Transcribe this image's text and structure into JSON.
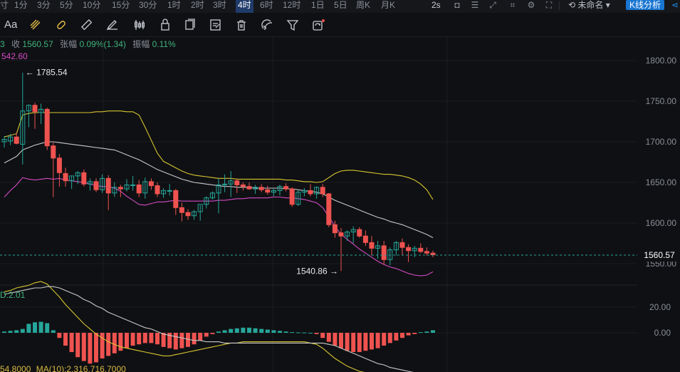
{
  "timeframes": {
    "items": [
      "寸",
      "1分",
      "3分",
      "5分",
      "10分",
      "15分",
      "30分",
      "1时",
      "2时",
      "3时",
      "4时",
      "6时",
      "12时",
      "1日",
      "5日",
      "周K",
      "月K"
    ],
    "active": "4时"
  },
  "topbar": {
    "interval": "2s",
    "layout_name": "未命名",
    "analysis_button": "K线分析"
  },
  "toolbar": {
    "font_tool_label": "Aa",
    "icons": [
      "line-tool-icon",
      "ray-tool-icon",
      "ruler-icon",
      "pen-icon",
      "candlestick-icon",
      "lock-icon",
      "copy-icon",
      "edit-icon",
      "trash-icon",
      "magnet-icon",
      "filter-icon",
      "sync-icon"
    ]
  },
  "info": {
    "prefix": "3",
    "close_label": "收",
    "close_value": "1560.57",
    "change_label": "张幅",
    "change_value": "0.09%(1.34)",
    "amplitude_label": "振幅",
    "amplitude_value": "0.11%",
    "ma_value": "542.60"
  },
  "colors": {
    "up": "#26a69a",
    "down": "#ef5350",
    "upper_band": "#d7c531",
    "mid_band": "#c8c8c8",
    "lower_band": "#d34bc5",
    "current_line": "#26a69a",
    "dif": "#d7c531",
    "dea": "#c8c8c8"
  },
  "price_axis": {
    "ticks": [
      "1800.00",
      "1750.00",
      "1700.00",
      "1650.00",
      "1600.00",
      "1550.00"
    ],
    "tick_values": [
      1800,
      1750,
      1700,
      1650,
      1600,
      1550
    ],
    "current_price": "1560.57"
  },
  "annotations": {
    "high": "1785.54",
    "low": "1540.86"
  },
  "macd_panel": {
    "label": "D:2.01",
    "ticks": [
      "20.00",
      "0.00"
    ],
    "tick_values": [
      20,
      0
    ]
  },
  "volume_line": {
    "text_a": "54.8000",
    "text_b": "MA(10):2,316,716.7000"
  },
  "chart_data": {
    "type": "candlestick",
    "series": [
      {
        "name": "candles",
        "ohlc": [
          [
            1700,
            1707,
            1693,
            1703
          ],
          [
            1701,
            1710,
            1696,
            1706
          ],
          [
            1706,
            1712,
            1697,
            1698
          ],
          [
            1697,
            1785,
            1672,
            1738
          ],
          [
            1738,
            1746,
            1718,
            1745
          ],
          [
            1745,
            1748,
            1716,
            1737
          ],
          [
            1736,
            1747,
            1722,
            1740
          ],
          [
            1740,
            1742,
            1690,
            1695
          ],
          [
            1695,
            1699,
            1632,
            1680
          ],
          [
            1680,
            1685,
            1645,
            1662
          ],
          [
            1661,
            1668,
            1645,
            1652
          ],
          [
            1652,
            1658,
            1642,
            1658
          ],
          [
            1658,
            1664,
            1648,
            1662
          ],
          [
            1662,
            1666,
            1645,
            1648
          ],
          [
            1648,
            1655,
            1640,
            1651
          ],
          [
            1651,
            1655,
            1638,
            1641
          ],
          [
            1641,
            1660,
            1637,
            1655
          ],
          [
            1655,
            1659,
            1616,
            1637
          ],
          [
            1637,
            1650,
            1632,
            1644
          ],
          [
            1644,
            1647,
            1632,
            1642
          ],
          [
            1642,
            1654,
            1639,
            1647
          ],
          [
            1647,
            1658,
            1640,
            1647
          ],
          [
            1647,
            1653,
            1632,
            1637
          ],
          [
            1637,
            1656,
            1630,
            1651
          ],
          [
            1651,
            1655,
            1641,
            1646
          ],
          [
            1646,
            1650,
            1632,
            1636
          ],
          [
            1636,
            1643,
            1631,
            1640
          ],
          [
            1640,
            1648,
            1634,
            1640
          ],
          [
            1640,
            1642,
            1610,
            1619
          ],
          [
            1619,
            1625,
            1602,
            1613
          ],
          [
            1613,
            1617,
            1604,
            1609
          ],
          [
            1609,
            1616,
            1604,
            1614
          ],
          [
            1614,
            1622,
            1603,
            1623
          ],
          [
            1623,
            1633,
            1618,
            1631
          ],
          [
            1631,
            1639,
            1629,
            1637
          ],
          [
            1637,
            1655,
            1612,
            1647
          ],
          [
            1647,
            1660,
            1638,
            1648
          ],
          [
            1648,
            1664,
            1632,
            1652
          ],
          [
            1652,
            1655,
            1637,
            1647
          ],
          [
            1647,
            1650,
            1640,
            1645
          ],
          [
            1645,
            1650,
            1641,
            1642
          ],
          [
            1642,
            1647,
            1636,
            1644
          ],
          [
            1644,
            1648,
            1638,
            1641
          ],
          [
            1641,
            1646,
            1635,
            1638
          ],
          [
            1638,
            1643,
            1633,
            1640
          ],
          [
            1640,
            1647,
            1634,
            1645
          ],
          [
            1645,
            1649,
            1639,
            1642
          ],
          [
            1642,
            1644,
            1620,
            1623
          ],
          [
            1623,
            1640,
            1621,
            1638
          ],
          [
            1638,
            1643,
            1633,
            1640
          ],
          [
            1640,
            1648,
            1633,
            1636
          ],
          [
            1636,
            1645,
            1630,
            1644
          ],
          [
            1644,
            1648,
            1632,
            1636
          ],
          [
            1636,
            1637,
            1595,
            1598
          ],
          [
            1598,
            1603,
            1582,
            1588
          ],
          [
            1588,
            1594,
            1541,
            1584
          ],
          [
            1584,
            1591,
            1578,
            1589
          ],
          [
            1589,
            1596,
            1575,
            1592
          ],
          [
            1592,
            1595,
            1582,
            1584
          ],
          [
            1584,
            1591,
            1572,
            1576
          ],
          [
            1576,
            1584,
            1560,
            1569
          ],
          [
            1569,
            1578,
            1556,
            1572
          ],
          [
            1572,
            1578,
            1549,
            1555
          ],
          [
            1555,
            1570,
            1548,
            1567
          ],
          [
            1567,
            1578,
            1560,
            1576
          ],
          [
            1576,
            1581,
            1561,
            1570
          ],
          [
            1570,
            1574,
            1552,
            1566
          ],
          [
            1566,
            1572,
            1558,
            1569
          ],
          [
            1569,
            1575,
            1563,
            1565
          ],
          [
            1565,
            1570,
            1560,
            1563
          ],
          [
            1563,
            1566,
            1558,
            1561
          ]
        ]
      },
      {
        "name": "upper_band",
        "values": [
          1706,
          1708,
          1710,
          1733,
          1735,
          1736,
          1736,
          1736,
          1736,
          1736,
          1736,
          1736,
          1736,
          1736,
          1736,
          1737,
          1737,
          1738,
          1738,
          1738,
          1737,
          1737,
          1733,
          1718,
          1702,
          1686,
          1676,
          1672,
          1668,
          1664,
          1661,
          1659,
          1658,
          1657,
          1656,
          1655,
          1655,
          1655,
          1654,
          1654,
          1654,
          1654,
          1654,
          1654,
          1654,
          1654,
          1653,
          1653,
          1652,
          1651,
          1651,
          1650,
          1651,
          1656,
          1661,
          1664,
          1665,
          1665,
          1664,
          1663,
          1662,
          1661,
          1660,
          1660,
          1659,
          1658,
          1656,
          1653,
          1648,
          1641,
          1629
        ]
      },
      {
        "name": "mid_band",
        "values": [
          1674,
          1678,
          1682,
          1690,
          1693,
          1696,
          1698,
          1700,
          1700,
          1699,
          1698,
          1697,
          1696,
          1695,
          1694,
          1693,
          1692,
          1691,
          1690,
          1687,
          1684,
          1681,
          1678,
          1674,
          1670,
          1666,
          1663,
          1660,
          1657,
          1654,
          1652,
          1650,
          1649,
          1648,
          1647,
          1646,
          1645,
          1645,
          1644,
          1644,
          1644,
          1643,
          1643,
          1643,
          1643,
          1643,
          1642,
          1642,
          1641,
          1640,
          1639,
          1638,
          1636,
          1632,
          1628,
          1625,
          1622,
          1619,
          1616,
          1613,
          1610,
          1607,
          1605,
          1602,
          1600,
          1598,
          1595,
          1592,
          1589,
          1586,
          1582
        ]
      },
      {
        "name": "lower_band",
        "values": [
          1632,
          1640,
          1647,
          1656,
          1654,
          1653,
          1654,
          1655,
          1654,
          1655,
          1653,
          1652,
          1651,
          1650,
          1648,
          1646,
          1645,
          1645,
          1643,
          1639,
          1633,
          1628,
          1623,
          1622,
          1624,
          1626,
          1626,
          1627,
          1628,
          1627,
          1627,
          1627,
          1627,
          1627,
          1627,
          1628,
          1628,
          1629,
          1630,
          1630,
          1631,
          1631,
          1631,
          1631,
          1632,
          1632,
          1631,
          1631,
          1630,
          1629,
          1627,
          1625,
          1619,
          1608,
          1596,
          1586,
          1580,
          1574,
          1568,
          1563,
          1558,
          1553,
          1549,
          1546,
          1544,
          1541,
          1538,
          1536,
          1535,
          1536,
          1540
        ]
      },
      {
        "name": "macd_hist",
        "values": [
          1.0,
          1.5,
          2.0,
          3.0,
          7.0,
          8.2,
          8.6,
          7.5,
          2.0,
          -4.0,
          -10.0,
          -15.0,
          -19.0,
          -22.0,
          -24.0,
          -23.0,
          -20.0,
          -18.0,
          -16.0,
          -14.0,
          -12.0,
          -10.0,
          -9.0,
          -8.0,
          -8.0,
          -9.0,
          -11.0,
          -12.0,
          -13.0,
          -12.0,
          -11.0,
          -9.0,
          -6.0,
          -3.0,
          -1.0,
          1.0,
          2.0,
          3.0,
          3.5,
          4.0,
          4.0,
          3.5,
          3.0,
          2.5,
          2.0,
          1.5,
          1.0,
          0.5,
          0.3,
          0.2,
          0.0,
          -1.0,
          -4.0,
          -7.0,
          -10.0,
          -12.0,
          -14.0,
          -15.0,
          -15.0,
          -14.0,
          -13.0,
          -12.0,
          -10.0,
          -8.0,
          -6.0,
          -4.0,
          -2.0,
          -1.0,
          0.5,
          1.0,
          2.01
        ]
      },
      {
        "name": "dif",
        "values": [
          32,
          33,
          35,
          36,
          37,
          39,
          40,
          38,
          33,
          28,
          22,
          17,
          12,
          7,
          3,
          -1,
          -4,
          -7,
          -9,
          -11,
          -12,
          -13,
          -14,
          -15,
          -16,
          -17,
          -18,
          -18,
          -17,
          -16,
          -15,
          -14,
          -13,
          -12,
          -11,
          -10,
          -9,
          -8,
          -8,
          -7,
          -7,
          -7,
          -7,
          -7,
          -7,
          -7,
          -7,
          -7,
          -7,
          -7,
          -8,
          -9,
          -12,
          -16,
          -20,
          -23,
          -26,
          -28,
          -30,
          -31,
          -32,
          -33,
          -33,
          -34,
          -34,
          -34,
          -34,
          -33,
          -33,
          -32,
          -31
        ]
      },
      {
        "name": "dea",
        "values": [
          30,
          31,
          32,
          33,
          34,
          35,
          35,
          36,
          36,
          35,
          33,
          31,
          29,
          26,
          24,
          21,
          19,
          16,
          14,
          12,
          10,
          8,
          6,
          4,
          3,
          1,
          -1,
          -2,
          -3,
          -4,
          -5,
          -6,
          -6,
          -7,
          -7,
          -7,
          -8,
          -8,
          -8,
          -8,
          -8,
          -8,
          -8,
          -8,
          -8,
          -8,
          -8,
          -8,
          -8,
          -8,
          -8,
          -8,
          -8,
          -9,
          -10,
          -12,
          -14,
          -16,
          -18,
          -20,
          -22,
          -24,
          -25,
          -27,
          -28,
          -29,
          -30,
          -31,
          -31,
          -32,
          -32
        ]
      }
    ],
    "price_range": [
      1530,
      1822
    ],
    "macd_range": [
      -31,
      36
    ],
    "legend": "none",
    "grid": true
  }
}
